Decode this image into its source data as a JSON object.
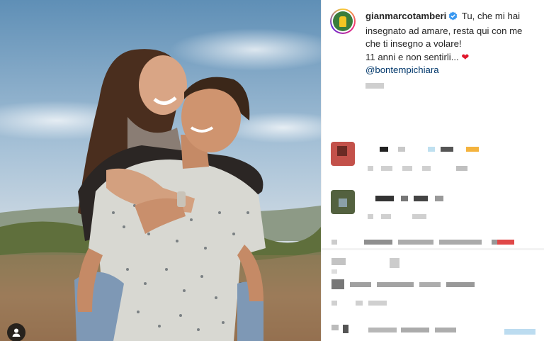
{
  "post": {
    "username": "gianmarcotamberi",
    "caption_line1": "Tu, che mi hai insegnato ad amare, resta qui con me che ti insegno a volare!",
    "caption_line2": "11 anni e non sentirli...",
    "heart": "❤",
    "mention": "@bontempichiara"
  },
  "icons": {
    "verified": "verified-badge-icon",
    "tag": "user-tag-icon",
    "heart": "heart-emoji-icon"
  },
  "colors": {
    "verified_blue": "#3897f0",
    "link": "#00376b",
    "text": "#262626",
    "heart": "#e0162b"
  }
}
